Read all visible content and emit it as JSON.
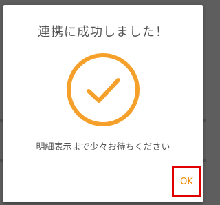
{
  "dialog": {
    "title": "連携に成功しました！",
    "message": "明細表示まで少々お待ちください",
    "ok_label": "OK",
    "icon": "check-circle-icon"
  },
  "colors": {
    "accent": "#f5a02a",
    "ok_text": "#f08a00",
    "highlight_border": "#e00000",
    "text": "#555555",
    "overlay": "#5e5e5e"
  }
}
